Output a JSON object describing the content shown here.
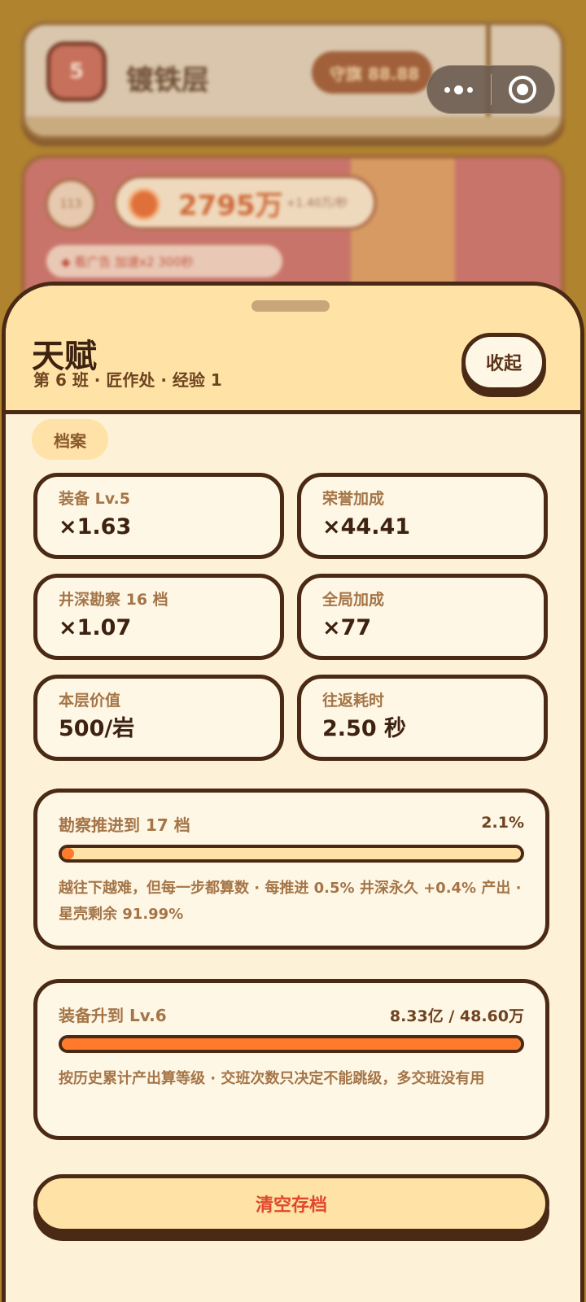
{
  "background": {
    "card1": {
      "badge": "5",
      "name": "镀铁层",
      "pill": "守旗 88.88"
    },
    "card2": {
      "level": "113",
      "coin_amount": "2795万",
      "coin_rate": "+1.40万/秒",
      "banner": "◆ 看广告 加速x2 300秒"
    }
  },
  "capsule": {
    "more_icon": "more-dots-icon",
    "close_icon": "close-ring-icon"
  },
  "sheet": {
    "title": "天赋",
    "subtitle": "第 6 班 · 匠作处 · 经验 1",
    "collapse_label": "收起",
    "section_tab": "档案",
    "stats": [
      {
        "label": "装备 Lv.5",
        "value": "×1.63"
      },
      {
        "label": "荣誉加成",
        "value": "×44.41"
      },
      {
        "label": "井深勘察 16 档",
        "value": "×1.07"
      },
      {
        "label": "全局加成",
        "value": "×77"
      },
      {
        "label": "本层价值",
        "value": "500/岩"
      },
      {
        "label": "往返耗时",
        "value": "2.50 秒"
      }
    ],
    "survey": {
      "title": "勘察推进到 17 档",
      "percent_label": "2.1%",
      "progress": 0.021,
      "note": "越往下越难，但每一步都算数 · 每推进 0.5% 井深永久 +0.4% 产出 · 星壳剩余 91.99%"
    },
    "equipment": {
      "title": "装备升到 Lv.6",
      "amount_label": "8.33亿 / 48.60万",
      "progress": 1.0,
      "note": "按历史累计产出算等级 · 交班次数只决定不能跳级，多交班没有用"
    },
    "clear_label": "清空存档"
  },
  "colors": {
    "accent_orange": "#ff7a2a",
    "danger_red": "#e0472c",
    "outline_brown": "#4a2a14",
    "cream": "#fff7e6",
    "header_yellow": "#ffe3a6"
  }
}
